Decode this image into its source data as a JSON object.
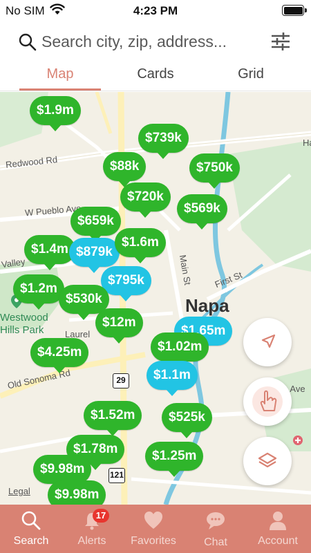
{
  "status_bar": {
    "carrier": "No SIM",
    "time": "4:23 PM",
    "battery_level": 1.0
  },
  "search": {
    "placeholder": "Search city, zip, address..."
  },
  "view_tabs": {
    "active": "Map",
    "items": [
      "Map",
      "Cards",
      "Grid"
    ]
  },
  "map": {
    "labels": {
      "city": "Napa",
      "park": "Westwood Hills Park",
      "park_line1": "Westwood",
      "park_line2": "Hills Park",
      "redwood": "Redwood Rd",
      "pueblo": "W Pueblo Ave",
      "valley": "Valley",
      "main": "Main St",
      "first": "First St",
      "laurel": "Laurel",
      "sonoma": "Old Sonoma Rd",
      "ave": "s Ave",
      "ha": "Ha"
    },
    "route_shields": [
      "29",
      "121"
    ],
    "legal": "Legal",
    "price_pins": [
      {
        "price": "$1.9m",
        "status": "green"
      },
      {
        "price": "$739k",
        "status": "green"
      },
      {
        "price": "$88k",
        "status": "green"
      },
      {
        "price": "$750k",
        "status": "green"
      },
      {
        "price": "$720k",
        "status": "green"
      },
      {
        "price": "$569k",
        "status": "green"
      },
      {
        "price": "$659k",
        "status": "green"
      },
      {
        "price": "$1.4m",
        "status": "green"
      },
      {
        "price": "$879k",
        "status": "blue"
      },
      {
        "price": "$1.6m",
        "status": "green"
      },
      {
        "price": "$795k",
        "status": "blue"
      },
      {
        "price": "$1.2m",
        "status": "green"
      },
      {
        "price": "$530k",
        "status": "green"
      },
      {
        "price": "$12m",
        "status": "green"
      },
      {
        "price": "$1.65m",
        "status": "blue"
      },
      {
        "price": "$1.02m",
        "status": "green"
      },
      {
        "price": "$4.25m",
        "status": "green"
      },
      {
        "price": "$1.1m",
        "status": "blue"
      },
      {
        "price": "$1.52m",
        "status": "green"
      },
      {
        "price": "$525k",
        "status": "green"
      },
      {
        "price": "$1.78m",
        "status": "green"
      },
      {
        "price": "$1.25m",
        "status": "green"
      },
      {
        "price": "$9.98m",
        "status": "green"
      },
      {
        "price": "$9.98m",
        "status": "green"
      }
    ]
  },
  "fabs": [
    "location-arrow-icon",
    "hand-pointer-icon",
    "layers-icon"
  ],
  "bottom_tabs": [
    {
      "label": "Search",
      "icon": "search-icon",
      "active": true
    },
    {
      "label": "Alerts",
      "icon": "bell-icon",
      "badge": "17"
    },
    {
      "label": "Favorites",
      "icon": "heart-icon"
    },
    {
      "label": "Chat",
      "icon": "chat-bubble-icon"
    },
    {
      "label": "Account",
      "icon": "user-icon"
    }
  ],
  "colors": {
    "accent": "#d98273",
    "pin_green": "#2fb52b",
    "pin_blue": "#22c4e4",
    "badge": "#e8352e"
  }
}
